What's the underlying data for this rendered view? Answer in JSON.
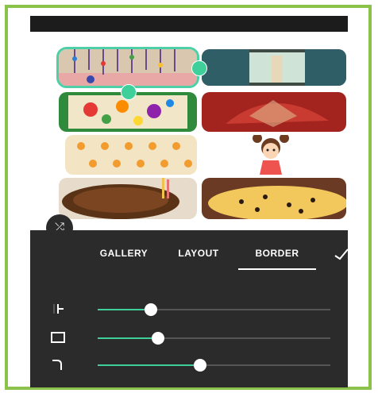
{
  "tabs": {
    "gallery": "GALLERY",
    "layout": "LAYOUT",
    "border": "BORDER"
  },
  "active_tab": "BORDER",
  "icons": {
    "shuffle": "shuffle-icon",
    "confirm": "checkmark-icon",
    "spacing": "spacing-icon",
    "border": "border-icon",
    "corner": "corner-radius-icon"
  },
  "sliders": [
    {
      "name": "spacing",
      "value": 0.23
    },
    {
      "name": "border",
      "value": 0.26
    },
    {
      "name": "corner-radius",
      "value": 0.44
    }
  ],
  "photos": [
    "hanging-beads",
    "curtains-window",
    "fabric-flowers",
    "red-embroidered-cloth",
    "orange-stars-paper",
    "cartoon-girl",
    "chocolate-cake",
    "pizza"
  ],
  "colors": {
    "accent": "#3ecf9b",
    "panel": "#2b2b2b",
    "frame": "#8bc34a"
  }
}
